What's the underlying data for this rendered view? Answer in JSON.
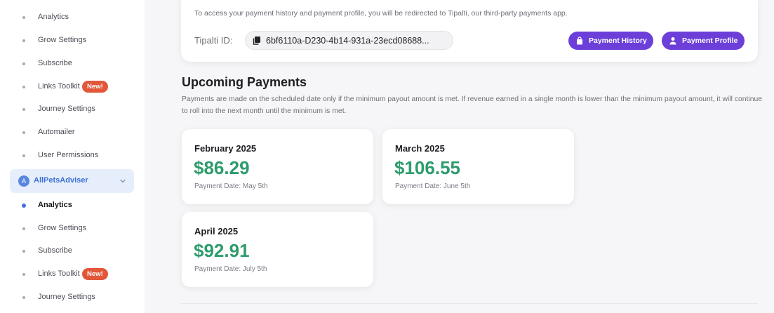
{
  "sidebar": {
    "items_top": [
      {
        "label": "Analytics"
      },
      {
        "label": "Grow Settings"
      },
      {
        "label": "Subscribe"
      },
      {
        "label": "Links Toolkit",
        "badge": "New!"
      },
      {
        "label": "Journey Settings"
      },
      {
        "label": "Automailer"
      },
      {
        "label": "User Permissions"
      }
    ],
    "site": {
      "avatar": "A",
      "name": "AllPetsAdviser"
    },
    "items_bottom": [
      {
        "label": "Analytics"
      },
      {
        "label": "Grow Settings"
      },
      {
        "label": "Subscribe"
      },
      {
        "label": "Links Toolkit",
        "badge": "New!"
      },
      {
        "label": "Journey Settings"
      }
    ]
  },
  "payments_info": {
    "text": "To access your payment history and payment profile, you will be redirected to Tipalti, our third-party payments app.",
    "tipalti_label": "Tipalti ID:",
    "tipalti_id": "6bf6110a-D230-4b14-931a-23ecd08688...",
    "history_button": "Payment History",
    "profile_button": "Payment Profile"
  },
  "upcoming": {
    "title": "Upcoming Payments",
    "description": "Payments are made on the scheduled date only if the minimum payout amount is met. If revenue earned in a single month is lower than the minimum payout amount, it will continue to roll into the next month until the minimum is met.",
    "cards": [
      {
        "month": "February 2025",
        "amount": "$86.29",
        "date": "Payment Date: May 5th"
      },
      {
        "month": "March 2025",
        "amount": "$106.55",
        "date": "Payment Date: June 5th"
      },
      {
        "month": "April 2025",
        "amount": "$92.91",
        "date": "Payment Date: July 5th"
      }
    ]
  },
  "colors": {
    "accent": "#6c3fd9",
    "amount": "#2e9b6c",
    "badge": "#e2573a",
    "site": "#3d6fd6"
  }
}
